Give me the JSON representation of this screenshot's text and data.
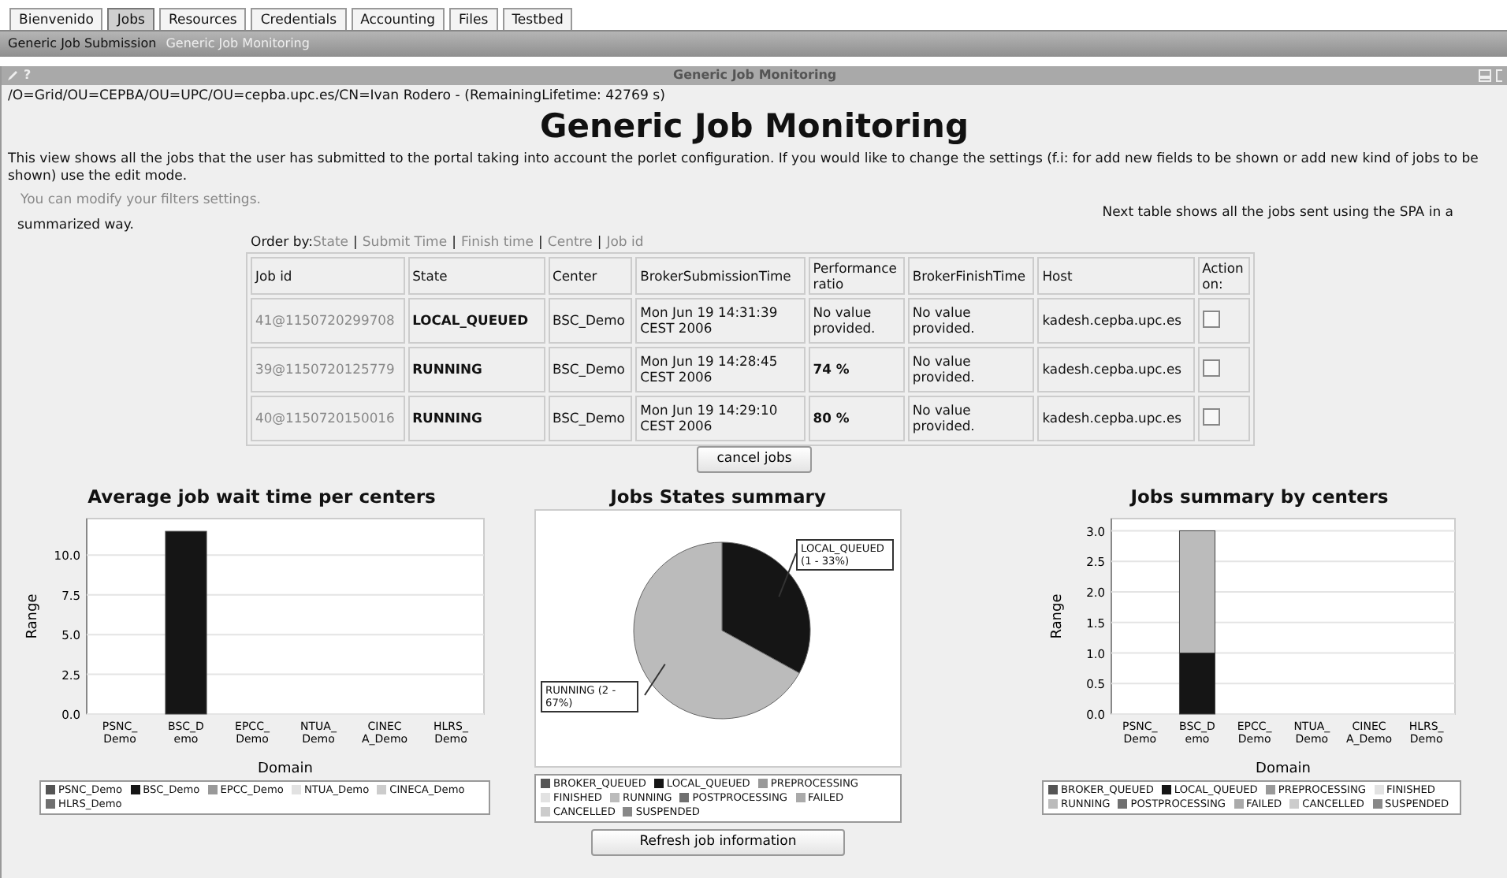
{
  "tabs": [
    {
      "label": "Bienvenido",
      "selected": false
    },
    {
      "label": "Jobs",
      "selected": true
    },
    {
      "label": "Resources",
      "selected": false
    },
    {
      "label": "Credentials",
      "selected": false
    },
    {
      "label": "Accounting",
      "selected": false
    },
    {
      "label": "Files",
      "selected": false
    },
    {
      "label": "Testbed",
      "selected": false
    }
  ],
  "subnav": [
    {
      "label": "Generic Job Submission",
      "selected": false
    },
    {
      "label": "Generic Job Monitoring",
      "selected": true
    }
  ],
  "portlet": {
    "title": "Generic Job Monitoring",
    "help": "?"
  },
  "user_dn": "/O=Grid/OU=CEPBA/OU=UPC/OU=cepba.upc.es/CN=Ivan Rodero - (RemainingLifetime: 42769 s)",
  "heading": "Generic Job Monitoring",
  "description": "This view shows all the jobs that the user has submitted to the portal taking into account the porlet configuration. If you would like to change the settings (f.i: for add new fields to be shown or add new kind of jobs to be shown) use the edit mode.",
  "filters_note": "You can modify your filters settings.",
  "table_note": "Next table shows all the jobs sent using the SPA in a",
  "table_note_end": "summarized way.",
  "order_by": {
    "label": "Order by:",
    "separator": "|",
    "links": [
      "State",
      "Submit Time",
      "Finish time",
      "Centre",
      "Job id"
    ]
  },
  "table": {
    "columns": [
      "Job id",
      "State",
      "Center",
      "BrokerSubmissionTime",
      "Performance ratio",
      "BrokerFinishTime",
      "Host",
      "Action on:"
    ],
    "rows": [
      {
        "job_id": "41@1150720299708",
        "state": "LOCAL_QUEUED",
        "center": "BSC_Demo",
        "submitted": "Mon Jun 19 14:31:39 CEST 2006",
        "performance": "No value provided.",
        "performance_bold": false,
        "finished": "No value provided.",
        "host": "kadesh.cepba.upc.es",
        "checked": false
      },
      {
        "job_id": "39@1150720125779",
        "state": "RUNNING",
        "center": "BSC_Demo",
        "submitted": "Mon Jun 19 14:28:45 CEST 2006",
        "performance": "74 %",
        "performance_bold": true,
        "finished": "No value provided.",
        "host": "kadesh.cepba.upc.es",
        "checked": false
      },
      {
        "job_id": "40@1150720150016",
        "state": "RUNNING",
        "center": "BSC_Demo",
        "submitted": "Mon Jun 19 14:29:10 CEST 2006",
        "performance": "80 %",
        "performance_bold": true,
        "finished": "No value provided.",
        "host": "kadesh.cepba.upc.es",
        "checked": false
      }
    ]
  },
  "cancel_button": "cancel jobs",
  "charts": [
    {
      "chart_data": {
        "type": "bar",
        "title": "Average job wait time per centers",
        "xlabel": "Domain",
        "ylabel": "Range",
        "grid": true,
        "categories": [
          "PSNC_Demo",
          "BSC_Demo",
          "EPCC_Demo",
          "NTUA_Demo",
          "CINECA_Demo",
          "HLRS_Demo"
        ],
        "values": [
          0,
          11.5,
          0,
          0,
          0,
          0
        ],
        "ylim": [
          0,
          12.3
        ],
        "yticks": [
          {
            "value": 0,
            "label": "0.0"
          },
          {
            "value": 2.5,
            "label": "2.5"
          },
          {
            "value": 5,
            "label": "5.0"
          },
          {
            "value": 7.5,
            "label": "7.5"
          },
          {
            "value": 10,
            "label": "10.0"
          }
        ]
      },
      "legend": [
        {
          "color": "#555555"
        },
        {
          "color": "#151515"
        },
        {
          "color": "#999999"
        },
        {
          "color": "#e2e2e2"
        },
        {
          "color": "#cccccc"
        },
        {
          "color": "#707070"
        }
      ]
    },
    {
      "chart_data": {
        "type": "pie",
        "title": "Jobs States summary",
        "categories": [
          "BROKER_QUEUED",
          "LOCAL_QUEUED",
          "PREPROCESSING",
          "FINISHED",
          "RUNNING",
          "POSTPROCESSING",
          "FAILED",
          "CANCELLED",
          "SUSPENDED"
        ],
        "values": [
          0,
          33,
          0,
          0,
          67,
          0,
          0,
          0,
          0
        ],
        "annotations": [
          {
            "text": "LOCAL_QUEUED (1 - 33%)"
          },
          {
            "text": "RUNNING (2 - 67%)"
          }
        ]
      },
      "legend": [
        {
          "color": "#555555"
        },
        {
          "color": "#151515"
        },
        {
          "color": "#999999"
        },
        {
          "color": "#e2e2e2"
        },
        {
          "color": "#bbbbbb"
        },
        {
          "color": "#707070"
        },
        {
          "color": "#aaaaaa"
        },
        {
          "color": "#cccccc"
        },
        {
          "color": "#888888"
        }
      ]
    },
    {
      "chart_data": {
        "type": "bar",
        "stacked": true,
        "title": "Jobs summary by centers",
        "xlabel": "Domain",
        "ylabel": "Range",
        "grid": true,
        "categories": [
          "PSNC_Demo",
          "BSC_Demo",
          "EPCC_Demo",
          "NTUA_Demo",
          "CINECA_Demo",
          "HLRS_Demo"
        ],
        "series": [
          {
            "name": "BROKER_QUEUED",
            "color": "#555555",
            "values": [
              0,
              0,
              0,
              0,
              0,
              0
            ]
          },
          {
            "name": "LOCAL_QUEUED",
            "color": "#151515",
            "values": [
              0,
              1,
              0,
              0,
              0,
              0
            ]
          },
          {
            "name": "PREPROCESSING",
            "color": "#999999",
            "values": [
              0,
              0,
              0,
              0,
              0,
              0
            ]
          },
          {
            "name": "FINISHED",
            "color": "#e2e2e2",
            "values": [
              0,
              0,
              0,
              0,
              0,
              0
            ]
          },
          {
            "name": "RUNNING",
            "color": "#bbbbbb",
            "values": [
              0,
              2,
              0,
              0,
              0,
              0
            ]
          },
          {
            "name": "POSTPROCESSING",
            "color": "#707070",
            "values": [
              0,
              0,
              0,
              0,
              0,
              0
            ]
          },
          {
            "name": "FAILED",
            "color": "#aaaaaa",
            "values": [
              0,
              0,
              0,
              0,
              0,
              0
            ]
          },
          {
            "name": "CANCELLED",
            "color": "#cccccc",
            "values": [
              0,
              0,
              0,
              0,
              0,
              0
            ]
          },
          {
            "name": "SUSPENDED",
            "color": "#888888",
            "values": [
              0,
              0,
              0,
              0,
              0,
              0
            ]
          }
        ],
        "ylim": [
          0,
          3.2
        ],
        "yticks": [
          {
            "value": 0,
            "label": "0.0"
          },
          {
            "value": 0.5,
            "label": "0.5"
          },
          {
            "value": 1,
            "label": "1.0"
          },
          {
            "value": 1.5,
            "label": "1.5"
          },
          {
            "value": 2,
            "label": "2.0"
          },
          {
            "value": 2.5,
            "label": "2.5"
          },
          {
            "value": 3,
            "label": "3.0"
          }
        ]
      }
    }
  ],
  "refresh_button": "Refresh job information"
}
